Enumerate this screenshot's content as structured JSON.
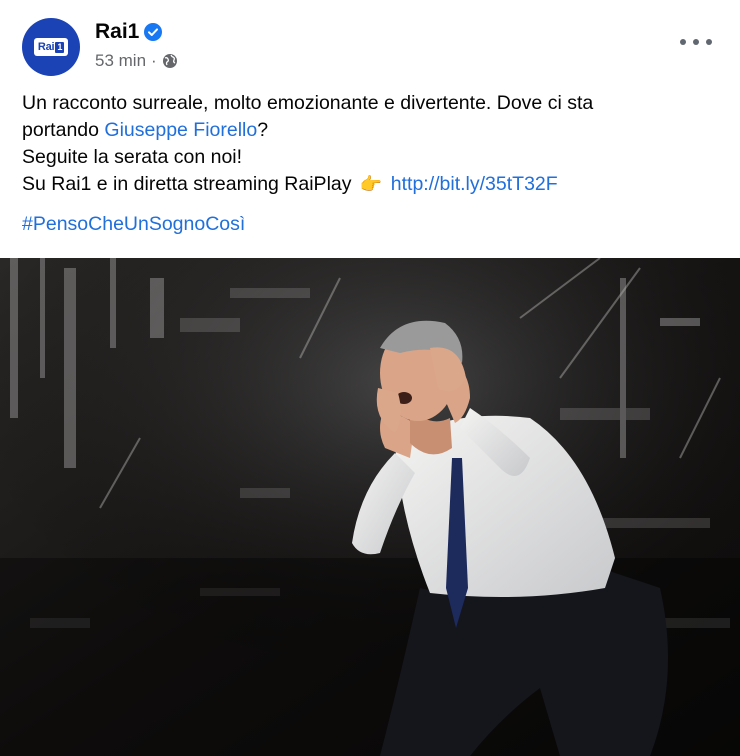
{
  "page": {
    "name": "Rai1",
    "time": "53 min",
    "separator": "·",
    "logo_text": "Rai",
    "logo_number": "1"
  },
  "post": {
    "line1": "Un racconto surreale, molto emozionante e divertente. Dove ci sta",
    "line2_prefix": "portando ",
    "line2_link": "Giuseppe Fiorello",
    "line2_suffix": "?",
    "line3": "Seguite la serata con noi!",
    "line4_prefix": "Su Rai1 e in diretta streaming RaiPlay",
    "line4_emoji": "👉",
    "line4_link": "http://bit.ly/35tT32F",
    "hashtag": "#PensoCheUnSognoCosì"
  },
  "icons": {
    "verified": "verified-badge-icon",
    "globe": "globe-icon",
    "more": "more-options-icon"
  },
  "colors": {
    "brand": "#1b43b6",
    "link": "#216fdb",
    "verified": "#1877f2",
    "meta": "#65676b"
  }
}
